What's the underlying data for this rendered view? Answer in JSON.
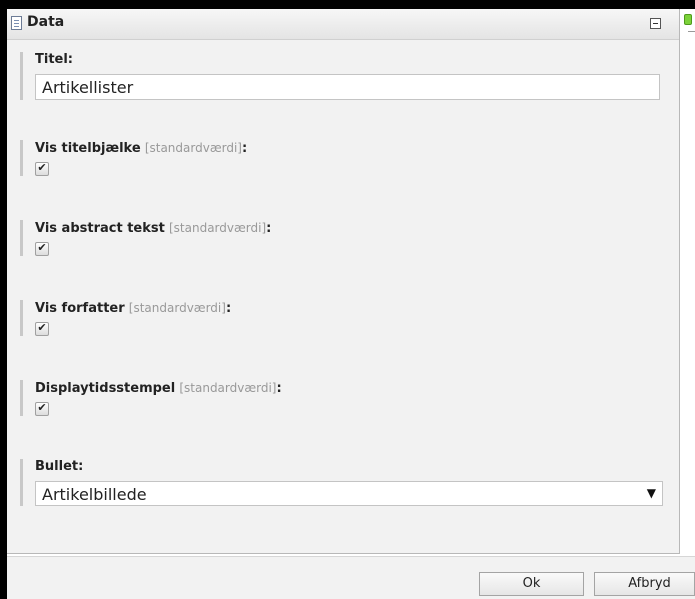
{
  "panel": {
    "title": "Data",
    "icons": {
      "header": "document-icon",
      "collapse": "collapse-icon",
      "status": "green-status-icon"
    }
  },
  "fields": {
    "title": {
      "label": "Titel:",
      "value": "Artikellister"
    },
    "show_title_bar": {
      "label": "Vis titelbjælke",
      "hint": "[standardværdi]",
      "colon": ":",
      "checked": true,
      "check_glyph": "✔"
    },
    "show_abstract": {
      "label": "Vis abstract tekst",
      "hint": "[standardværdi]",
      "colon": ":",
      "checked": true,
      "check_glyph": "✔"
    },
    "show_author": {
      "label": "Vis forfatter",
      "hint": "[standardværdi]",
      "colon": ":",
      "checked": true,
      "check_glyph": "✔"
    },
    "display_timestamp": {
      "label": "Displaytidsstempel",
      "hint": "[standardværdi]",
      "colon": ":",
      "checked": true,
      "check_glyph": "✔"
    },
    "bullet": {
      "label": "Bullet:",
      "selected": "Artikelbillede",
      "arrow": "▼"
    }
  },
  "footer": {
    "ok_label": "Ok",
    "cancel_label": "Afbryd"
  }
}
